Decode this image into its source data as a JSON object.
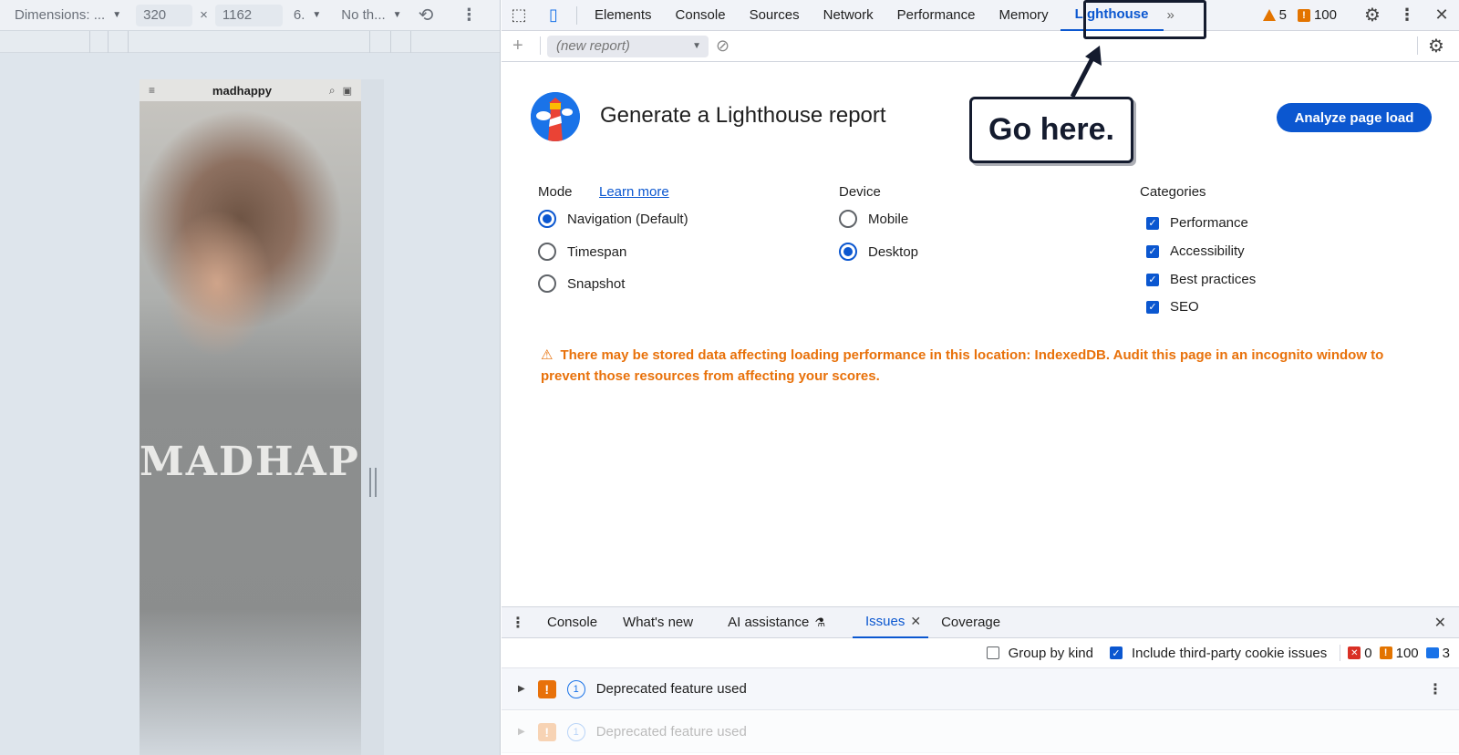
{
  "device_toolbar": {
    "dimensions_label": "Dimensions: ...",
    "width": "320",
    "times": "×",
    "height": "1162",
    "zoom": "6.",
    "throttle": "No th..."
  },
  "phone": {
    "brand": "madhappy",
    "shirt_text": "MADHAPPY"
  },
  "devtools": {
    "tabs": [
      "Elements",
      "Console",
      "Sources",
      "Network",
      "Performance",
      "Memory",
      "Lighthouse"
    ],
    "active_tab": "Lighthouse",
    "warnings_count": "5",
    "issues_count": "100",
    "more_tabs": "»",
    "close": "✕",
    "new_report_placeholder": "(new report)"
  },
  "lighthouse": {
    "title": "Generate a Lighthouse report",
    "analyze_button": "Analyze page load",
    "mode_heading": "Mode",
    "learn_more": "Learn more",
    "mode_options": [
      "Navigation (Default)",
      "Timespan",
      "Snapshot"
    ],
    "mode_selected": "Navigation (Default)",
    "device_heading": "Device",
    "device_options": [
      "Mobile",
      "Desktop"
    ],
    "device_selected": "Desktop",
    "categories_heading": "Categories",
    "categories": [
      "Performance",
      "Accessibility",
      "Best practices",
      "SEO"
    ],
    "warning": "There may be stored data affecting loading performance in this location: IndexedDB. Audit this page in an incognito window to prevent those resources from affecting your scores."
  },
  "callout": {
    "text": "Go here."
  },
  "drawer": {
    "tabs": [
      "Console",
      "What's new",
      "AI assistance",
      "Issues",
      "Coverage"
    ],
    "active_tab": "Issues",
    "group_by_kind": "Group by kind",
    "include_third_party": "Include third-party cookie issues",
    "error_count": "0",
    "warning_count": "100",
    "info_count": "3",
    "issues": [
      {
        "count": "1",
        "title": "Deprecated feature used"
      },
      {
        "count": "1",
        "title": "Deprecated feature used"
      }
    ]
  },
  "colors": {
    "accent": "#0b57d0",
    "warning": "#e8710a",
    "callout_border": "#141b2e"
  }
}
